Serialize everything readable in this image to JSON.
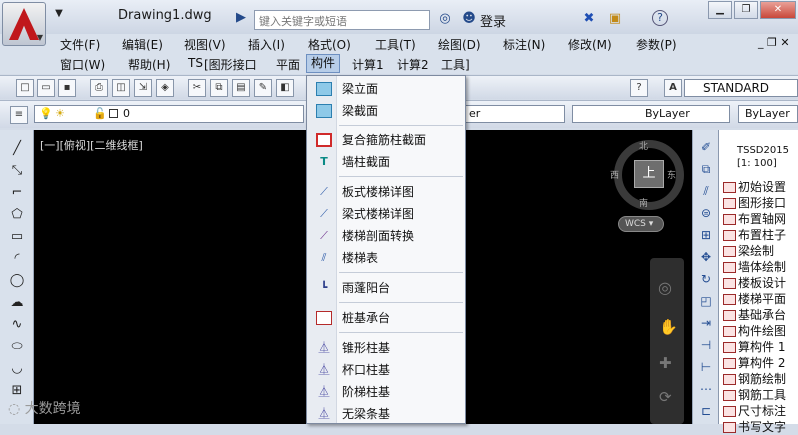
{
  "title_bar": {
    "document": "Drawing1.dwg",
    "search_placeholder": "键入关键字或短语",
    "login": "登录"
  },
  "menu_row1": [
    "文件(F)",
    "编辑(E)",
    "视图(V)",
    "插入(I)",
    "格式(O)",
    "工具(T)",
    "绘图(D)",
    "标注(N)",
    "修改(M)",
    "参数(P)"
  ],
  "menu_row2": [
    "窗口(W)",
    "帮助(H)",
    "TS",
    "[图形接口",
    "平面",
    "构件",
    "计算1",
    "计算2",
    "工具]"
  ],
  "active_menu": "构件",
  "toolbar": {
    "text_style": "STANDARD",
    "layer_value": "0",
    "linetype": "ByLayer",
    "lineweight": "ByLayer",
    "layer_partial": "er"
  },
  "viewport": {
    "label": "[一][俯视][二维线框]",
    "compass": {
      "north": "北",
      "south": "南",
      "east": "东",
      "west": "西",
      "center": "上"
    },
    "wcs": "WCS"
  },
  "dropdown": {
    "groups": [
      [
        {
          "label": "梁立面",
          "icon": "beam-elevation-icon"
        },
        {
          "label": "梁截面",
          "icon": "beam-section-icon"
        }
      ],
      [
        {
          "label": "复合箍筋柱截面",
          "icon": "composite-stirrup-icon"
        },
        {
          "label": "墙柱截面",
          "icon": "wall-column-icon"
        }
      ],
      [
        {
          "label": "板式楼梯详图",
          "icon": "plate-stair-icon"
        },
        {
          "label": "梁式楼梯详图",
          "icon": "beam-stair-icon"
        },
        {
          "label": "楼梯剖面转换",
          "icon": "stair-section-icon"
        },
        {
          "label": "楼梯表",
          "icon": "stair-table-icon"
        }
      ],
      [
        {
          "label": "雨蓬阳台",
          "icon": "canopy-balcony-icon"
        }
      ],
      [
        {
          "label": "桩基承台",
          "icon": "pile-cap-icon"
        }
      ],
      [
        {
          "label": "锥形柱基",
          "icon": "cone-footing-icon"
        },
        {
          "label": "杯口柱基",
          "icon": "cup-footing-icon"
        },
        {
          "label": "阶梯柱基",
          "icon": "step-footing-icon"
        },
        {
          "label": "无梁条基",
          "icon": "strip-footing-icon"
        }
      ]
    ]
  },
  "tssd_panel": {
    "header1": "TSSD2015",
    "header2": "[1: 100]",
    "items": [
      "初始设置",
      "图形接口",
      "布置轴网",
      "布置柱子",
      "梁绘制",
      "墙体绘制",
      "楼板设计",
      "楼梯平面",
      "基础承台",
      "构件绘图",
      "算构件 1",
      "算构件 2",
      "钢筋绘制",
      "钢筋工具",
      "尺寸标注",
      "书写文字"
    ]
  },
  "watermark": "大数跨境"
}
